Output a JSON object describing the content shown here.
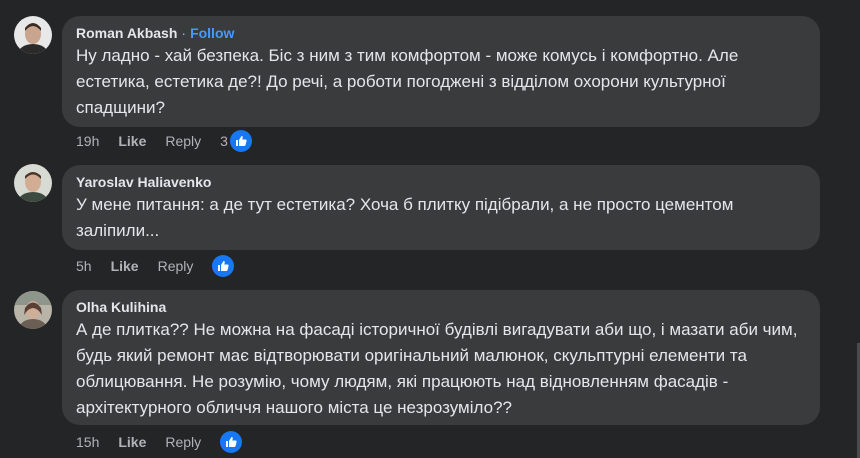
{
  "comments": [
    {
      "author": "Roman Akbash",
      "separator": "·",
      "follow_label": "Follow",
      "text": "Ну ладно - хай безпека. Біс з ним з тим комфортом - може комусь і комфортно. Але естетика, естетика де?! До речі, а роботи погоджені з відділом охорони культурної спадщини?",
      "time": "19h",
      "like_label": "Like",
      "reply_label": "Reply",
      "reaction_count": "3",
      "reaction_icon": "thumbs-up-icon"
    },
    {
      "author": "Yaroslav Haliavenko",
      "text": "У мене питання: а де тут естетика? Хоча б плитку підібрали, а не просто цементом заліпили...",
      "time": "5h",
      "like_label": "Like",
      "reply_label": "Reply",
      "reaction_icon": "thumbs-up-icon"
    },
    {
      "author": "Olha Kulihina",
      "text": "А де плитка?? Не можна на фасаді історичної будівлі вигадувати аби що, і мазати аби чим, будь який ремонт має відтворювати оригінальний малюнок, скульптурні елементи та облицювання. Не розумію, чому людям, які працюють над відновленням фасадів - архітектурного обличчя нашого міста це незрозуміло??",
      "time": "15h",
      "like_label": "Like",
      "reply_label": "Reply",
      "reaction_icon": "thumbs-up-icon"
    }
  ],
  "colors": {
    "background": "#242526",
    "bubble": "#3a3b3c",
    "text": "#e4e6eb",
    "secondary": "#b0b3b8",
    "follow": "#4599ff",
    "like_badge": "#1877f2"
  }
}
